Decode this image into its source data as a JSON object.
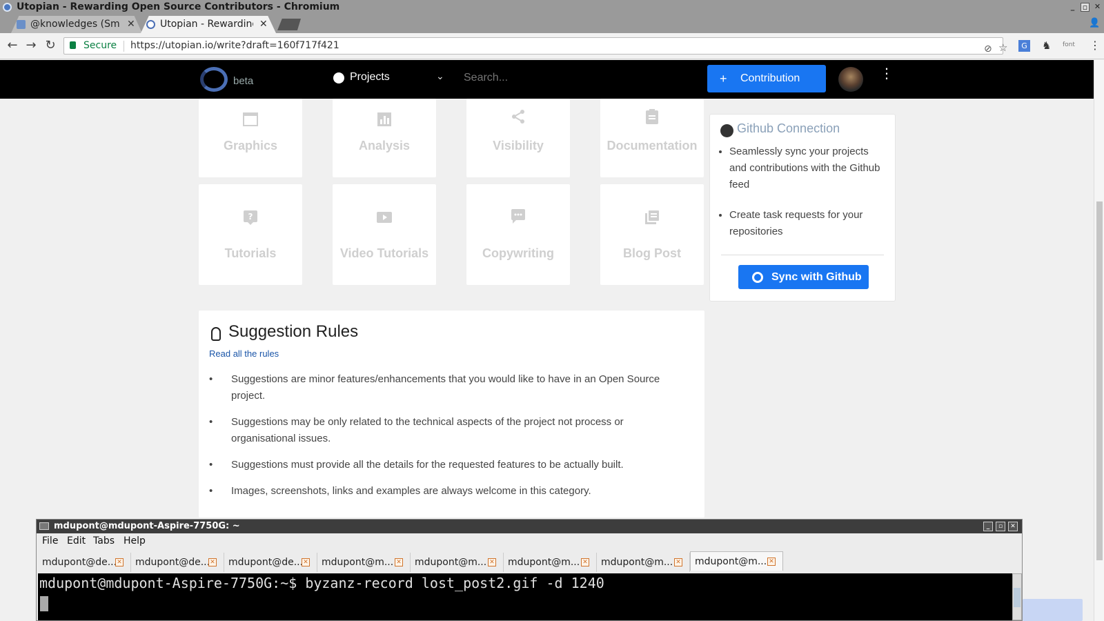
{
  "window": {
    "title": "Utopian - Rewarding Open Source Contributors - Chromium"
  },
  "browser": {
    "tabs": [
      {
        "label": "@knowledges (Smil",
        "active": false
      },
      {
        "label": "Utopian - Rewarding",
        "active": true
      }
    ],
    "secure_label": "Secure",
    "url": "https://utopian.io/write?draft=160f717f421",
    "font_ext": "font"
  },
  "site_nav": {
    "beta": "beta",
    "projects": "Projects",
    "search_placeholder": "Search...",
    "contribution_label": "Contribution",
    "contribution_plus": "+"
  },
  "categories": [
    {
      "label": "Graphics",
      "icon": "window-icon"
    },
    {
      "label": "Analysis",
      "icon": "bar-chart-icon"
    },
    {
      "label": "Visibility",
      "icon": "share-icon"
    },
    {
      "label": "Documentation",
      "icon": "clipboard-icon"
    },
    {
      "label": "Tutorials",
      "icon": "help-icon"
    },
    {
      "label": "Video Tutorials",
      "icon": "video-icon"
    },
    {
      "label": "Copywriting",
      "icon": "chat-icon"
    },
    {
      "label": "Blog Post",
      "icon": "library-icon"
    }
  ],
  "github_panel": {
    "title": "Github Connection",
    "items": [
      "Seamlessly sync your projects and contributions with the Github feed",
      "Create task requests for your repositories"
    ],
    "sync_label": "Sync with Github"
  },
  "rules": {
    "title": "Suggestion Rules",
    "link": "Read all the rules",
    "items": [
      "Suggestions are minor features/enhancements that you would like to have in an Open Source project.",
      "Suggestions may be only related to the technical aspects of the project not process or organisational issues.",
      "Suggestions must provide all the details for the requested features to be actually built.",
      "Images, screenshots, links and examples are always welcome in this category."
    ]
  },
  "terminal": {
    "title": "mdupont@mdupont-Aspire-7750G: ~",
    "menus": [
      "File",
      "Edit",
      "Tabs",
      "Help"
    ],
    "tabs": [
      "mdupont@de...",
      "mdupont@de...",
      "mdupont@de...",
      "mdupont@m...",
      "mdupont@m...",
      "mdupont@m...",
      "mdupont@m...",
      "mdupont@m..."
    ],
    "active_tab": 7,
    "prompt_line": "mdupont@mdupont-Aspire-7750G:~$ byzanz-record lost_post2.gif -d 1240"
  }
}
